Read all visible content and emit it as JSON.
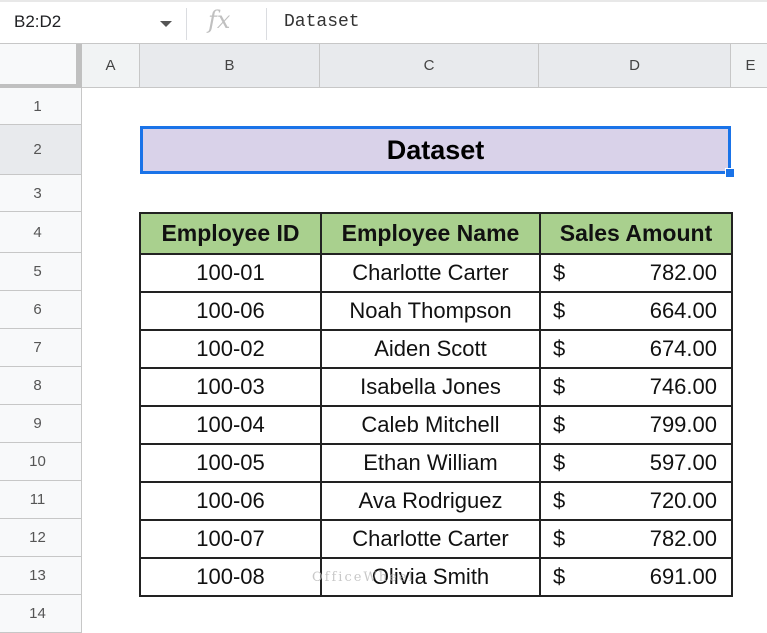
{
  "formula_bar": {
    "name_box": "B2:D2",
    "fx": "fx",
    "value": "Dataset"
  },
  "columns": [
    "A",
    "B",
    "C",
    "D",
    "E"
  ],
  "rows": [
    "1",
    "2",
    "3",
    "4",
    "5",
    "6",
    "7",
    "8",
    "9",
    "10",
    "11",
    "12",
    "13",
    "14"
  ],
  "title": "Dataset",
  "table": {
    "headers": [
      "Employee ID",
      "Employee Name",
      "Sales Amount"
    ],
    "currency": "$",
    "rows": [
      {
        "id": "100-01",
        "name": "Charlotte Carter",
        "amount": "782.00"
      },
      {
        "id": "100-06",
        "name": "Noah Thompson",
        "amount": "664.00"
      },
      {
        "id": "100-02",
        "name": "Aiden Scott",
        "amount": "674.00"
      },
      {
        "id": "100-03",
        "name": "Isabella Jones",
        "amount": "746.00"
      },
      {
        "id": "100-04",
        "name": "Caleb Mitchell",
        "amount": "799.00"
      },
      {
        "id": "100-05",
        "name": "Ethan William",
        "amount": "597.00"
      },
      {
        "id": "100-06",
        "name": "Ava Rodriguez",
        "amount": "720.00"
      },
      {
        "id": "100-07",
        "name": "Charlotte Carter",
        "amount": "782.00"
      },
      {
        "id": "100-08",
        "name": "Olivia Smith",
        "amount": "691.00"
      }
    ]
  },
  "watermark": "OfficeWheel"
}
